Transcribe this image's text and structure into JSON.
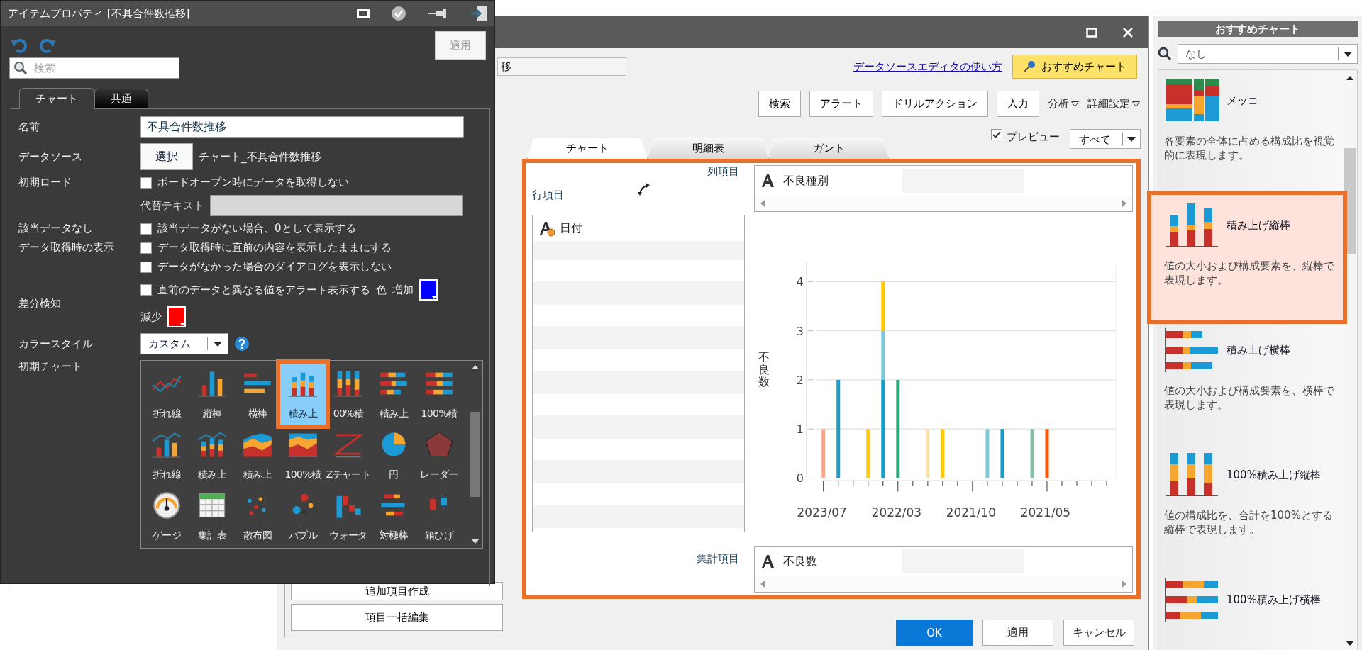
{
  "property_panel": {
    "title": "アイテムプロパティ [不具合件数推移]",
    "apply_button": {
      "label": "適用",
      "disabled": true
    },
    "search": {
      "placeholder": "検索"
    },
    "tabs": [
      {
        "label": "チャート",
        "selected": true
      },
      {
        "label": "共通",
        "selected": false
      }
    ],
    "name": {
      "label": "名前",
      "value": "不具合件数推移"
    },
    "data_source": {
      "label": "データソース",
      "button": "選択",
      "value": "チャート_不具合件数推移"
    },
    "initial_load": {
      "label": "初期ロード",
      "option": {
        "text": "ボードオープン時にデータを取得しない",
        "checked": false
      },
      "alt_text": {
        "label": "代替テキスト",
        "disabled": true
      }
    },
    "no_data": {
      "label": "該当データなし",
      "option": {
        "text": "該当データがない場合、0として表示する",
        "checked": false
      }
    },
    "fetch_display": {
      "label": "データ取得時の表示",
      "options": [
        {
          "text": "データ取得時に直前の内容を表示したままにする",
          "checked": false
        },
        {
          "text": "データがなかった場合のダイアログを表示しない",
          "checked": false
        }
      ]
    },
    "diff": {
      "label": "差分検知",
      "option": {
        "text": "直前のデータと異なる値をアラート表示する",
        "checked": false
      },
      "color_label": "色",
      "increase": {
        "label": "増加",
        "color": "#0000ff"
      },
      "decrease": {
        "label": "減少",
        "color": "#ff0000"
      }
    },
    "color_style": {
      "label": "カラースタイル",
      "value": "カスタム"
    },
    "initial_chart": {
      "label": "初期チャート",
      "items": [
        {
          "label": "折れ線",
          "selected": false
        },
        {
          "label": "縦棒",
          "selected": false
        },
        {
          "label": "横棒",
          "selected": false
        },
        {
          "label": "積み上",
          "selected": true
        },
        {
          "label": "00%積",
          "selected": false
        },
        {
          "label": "積み上",
          "selected": false
        },
        {
          "label": "100%積",
          "selected": false
        },
        {
          "label": "折れ線",
          "selected": false
        },
        {
          "label": "積み上",
          "selected": false
        },
        {
          "label": "積み上",
          "selected": false
        },
        {
          "label": "100%積",
          "selected": false
        },
        {
          "label": "Zチャート",
          "selected": false
        },
        {
          "label": "円",
          "selected": false
        },
        {
          "label": "レーダー",
          "selected": false
        },
        {
          "label": "ゲージ",
          "selected": false
        },
        {
          "label": "集計表",
          "selected": false
        },
        {
          "label": "散布図",
          "selected": false
        },
        {
          "label": "バブル",
          "selected": false
        },
        {
          "label": "ウォータ",
          "selected": false
        },
        {
          "label": "対極棒",
          "selected": false
        },
        {
          "label": "箱ひげ",
          "selected": false
        }
      ]
    }
  },
  "editor": {
    "name_field": {
      "value": "移"
    },
    "help_link": "データソースエディタの使い方",
    "recommend_button": "おすすめチャート",
    "toolbar": [
      {
        "label": "検索",
        "kind": "button"
      },
      {
        "label": "アラート",
        "kind": "button"
      },
      {
        "label": "ドリルアクション",
        "kind": "button"
      },
      {
        "label": "入力",
        "kind": "button"
      },
      {
        "label": "分析",
        "kind": "menu"
      },
      {
        "label": "詳細設定",
        "kind": "menu"
      }
    ],
    "preview": {
      "label": "プレビュー",
      "checked": true
    },
    "filter": {
      "value": "すべて"
    },
    "tabs": [
      {
        "label": "チャート",
        "selected": true
      },
      {
        "label": "明細表",
        "selected": false
      },
      {
        "label": "ガント",
        "selected": false
      }
    ],
    "column_items": {
      "label": "列項目",
      "items": [
        "不良種別"
      ]
    },
    "row_items": {
      "label": "行項目",
      "items": [
        "日付"
      ]
    },
    "value_items": {
      "label": "集計項目",
      "items": [
        "不良数"
      ]
    },
    "chart_data": {
      "type": "bar",
      "stacked": true,
      "grid": true,
      "ylabel": "不良数",
      "categories": [
        "2023/07",
        null,
        null,
        null,
        null,
        "2022/03",
        null,
        null,
        null,
        null,
        "2021/10",
        null,
        null,
        null,
        null,
        "2021/05",
        null,
        null,
        null,
        null
      ],
      "yticks": [
        0,
        1,
        2,
        3,
        4
      ],
      "ylim": [
        0,
        4.4
      ],
      "series": [
        {
          "color": "#f7a88c",
          "values": [
            1,
            null,
            null,
            null,
            null,
            null,
            null,
            null,
            null,
            null,
            null,
            null,
            null,
            null,
            null,
            null,
            null,
            null,
            null,
            null
          ]
        },
        {
          "color": "#1a9cc4",
          "values": [
            null,
            2,
            null,
            null,
            2,
            null,
            null,
            null,
            null,
            null,
            null,
            null,
            1,
            null,
            null,
            null,
            null,
            null,
            null,
            null
          ]
        },
        {
          "color": "#7cc8d8",
          "values": [
            null,
            null,
            null,
            null,
            1,
            null,
            null,
            null,
            null,
            null,
            null,
            1,
            null,
            null,
            null,
            null,
            null,
            null,
            null,
            null
          ]
        },
        {
          "color": "#ffc800",
          "values": [
            null,
            null,
            null,
            1,
            1,
            null,
            null,
            null,
            1,
            null,
            null,
            null,
            null,
            null,
            null,
            null,
            null,
            null,
            null,
            null
          ]
        },
        {
          "color": "#2eab78",
          "values": [
            null,
            null,
            null,
            null,
            null,
            2,
            null,
            null,
            null,
            null,
            null,
            null,
            null,
            null,
            null,
            null,
            null,
            null,
            null,
            null
          ]
        },
        {
          "color": "#f8e2a8",
          "values": [
            null,
            null,
            null,
            null,
            null,
            null,
            null,
            1,
            null,
            null,
            null,
            null,
            null,
            null,
            null,
            null,
            null,
            null,
            null,
            null
          ]
        },
        {
          "color": "#86c0a0",
          "values": [
            null,
            null,
            null,
            null,
            null,
            null,
            null,
            null,
            null,
            null,
            null,
            null,
            null,
            null,
            1,
            null,
            null,
            null,
            null,
            null
          ]
        },
        {
          "color": "#ff5500",
          "values": [
            null,
            null,
            null,
            null,
            null,
            null,
            null,
            null,
            null,
            null,
            null,
            null,
            null,
            null,
            null,
            1,
            null,
            null,
            null,
            null
          ]
        }
      ]
    },
    "side_buttons": [
      "追加項目作成",
      "項目一括編集"
    ],
    "buttons": [
      {
        "label": "OK",
        "primary": true
      },
      {
        "label": "適用",
        "primary": false
      },
      {
        "label": "キャンセル",
        "primary": false
      }
    ]
  },
  "recommend_panel": {
    "title": "おすすめチャート",
    "filter": {
      "value": "なし"
    },
    "items": [
      {
        "name": "メッコ",
        "description": "各要素の全体に占める構成比を視覚的に表現します。",
        "selected": false
      },
      {
        "name": "積み上げ縦棒",
        "description": "値の大小および構成要素を、縦棒で表現します。",
        "selected": true
      },
      {
        "name": "積み上げ横棒",
        "description": "値の大小および構成要素を、横棒で表現します。",
        "selected": false
      },
      {
        "name": "100%積み上げ縦棒",
        "description": "値の構成比を、合計を100%とする縦棒で表現します。",
        "selected": false
      },
      {
        "name": "100%積み上げ横棒",
        "selected": false
      }
    ]
  }
}
